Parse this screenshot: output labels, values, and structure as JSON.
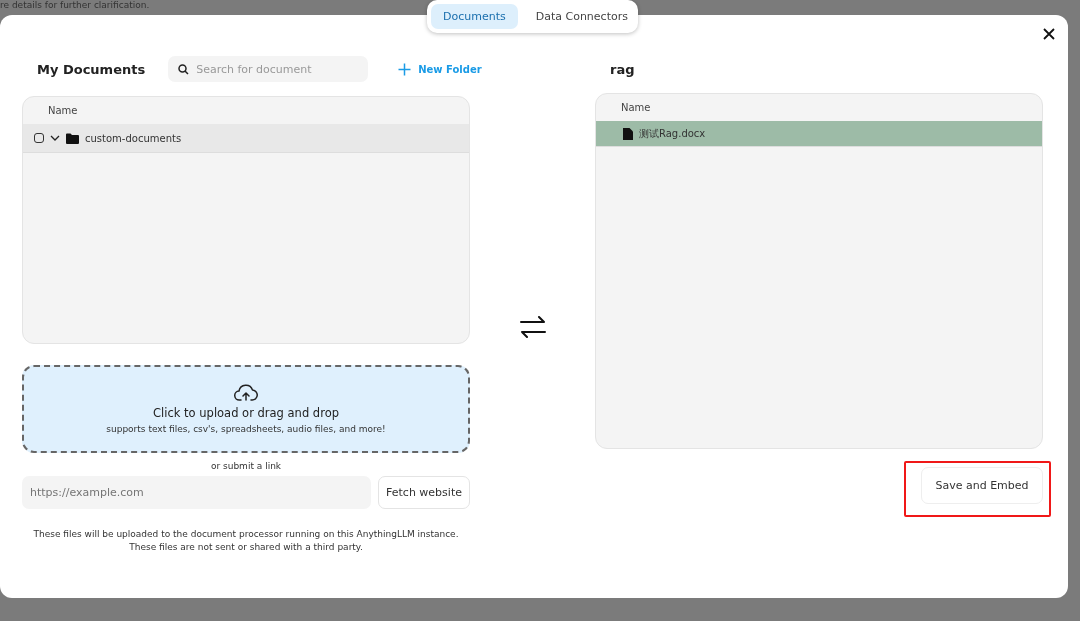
{
  "background_text": "re details for further clarification.",
  "tabs": [
    {
      "label": "Documents",
      "selected": true
    },
    {
      "label": "Data Connectors",
      "selected": false
    }
  ],
  "my_documents": {
    "title": "My Documents",
    "search": {
      "placeholder": "Search for document"
    },
    "new_folder": "New Folder",
    "table": {
      "columns": [
        "Name"
      ],
      "rows": [
        {
          "name": "custom-documents",
          "kind": "folder",
          "checked": false,
          "expanded": true
        }
      ]
    }
  },
  "upload": {
    "title": "Click to upload or drag and drop",
    "subtitle": "supports text files, csv's, spreadsheets, audio files, and more!",
    "link_hint": "or submit a link",
    "url": {
      "placeholder": "https://example.com"
    },
    "fetch_button": "Fetch website",
    "notice": [
      "These files will be uploaded to the document processor running on this AnythingLLM instance.",
      "These files are not sent or shared with a third party."
    ]
  },
  "workspace": {
    "title": "rag",
    "table": {
      "columns": [
        "Name"
      ],
      "rows": [
        {
          "name": "测试Rag.docx",
          "kind": "file",
          "selected": true
        }
      ]
    },
    "save_button": {
      "label": "Save and Embed",
      "highlighted": true
    }
  }
}
